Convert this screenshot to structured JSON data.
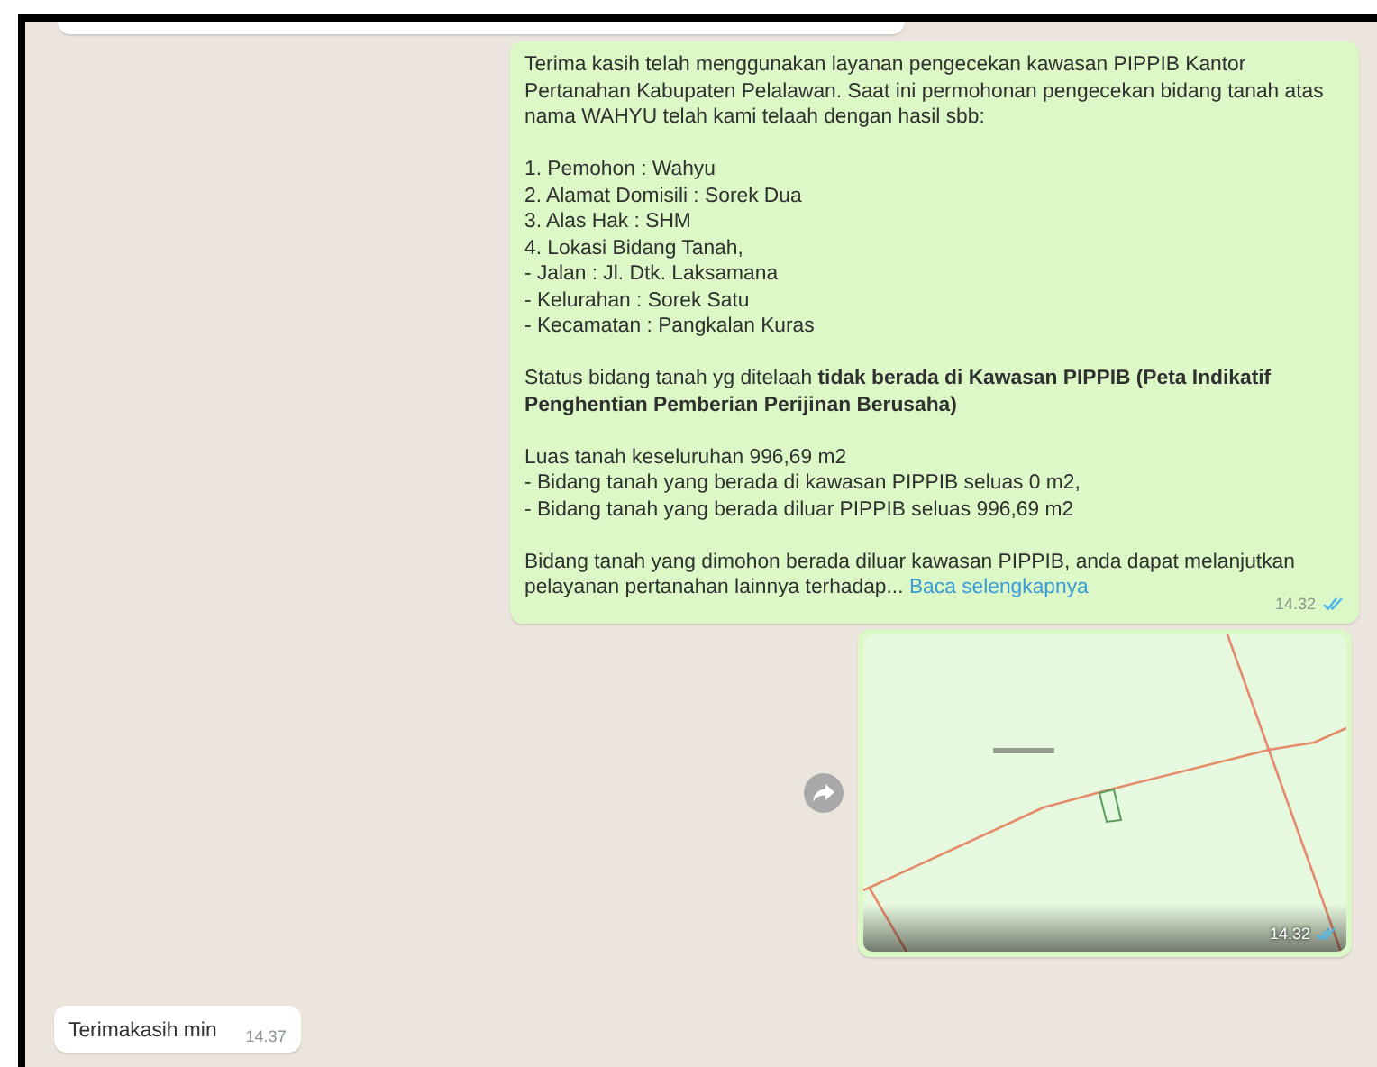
{
  "messages": [
    {
      "kind": "cut",
      "outgoing": false
    },
    {
      "kind": "text",
      "outgoing": true,
      "paragraphs": [
        [
          "Terima kasih telah menggunakan layanan pengecekan kawasan PIPPIB Kantor Pertanahan Kabupaten Pelalawan. Saat ini permohonan pengecekan bidang tanah atas nama WAHYU telah kami telaah dengan hasil sbb:"
        ],
        [
          "1. Pemohon : Wahyu",
          "2. Alamat Domisili : Sorek Dua",
          "3. Alas Hak : SHM",
          "4. Lokasi Bidang Tanah,",
          "- Jalan : Jl. Dtk. Laksamana",
          "- Kelurahan : Sorek Satu",
          "- Kecamatan : Pangkalan Kuras"
        ],
        [
          "Status bidang tanah yg ditelaah **tidak berada di Kawasan PIPPIB (Peta Indikatif Penghentian Pemberian Perijinan Berusaha)**"
        ],
        [
          "Luas tanah keseluruhan  996,69 m2",
          "- Bidang tanah yang berada di kawasan PIPPIB seluas 0 m2,",
          "- Bidang tanah yang berada diluar PIPPIB seluas 996,69 m2"
        ],
        [
          "Bidang tanah yang dimohon berada diluar kawasan PIPPIB, anda dapat melanjutkan pelayanan pertanahan lainnya terhadap..."
        ]
      ],
      "more_link": "Baca selengkapnya",
      "time": "14.32",
      "read": true
    },
    {
      "outgoing": true,
      "time": "14.32",
      "read": true
    },
    {
      "kind": "text",
      "outgoing": false,
      "paragraphs": [
        [
          "Terimakasih min"
        ]
      ],
      "time": "14.37"
    }
  ]
}
